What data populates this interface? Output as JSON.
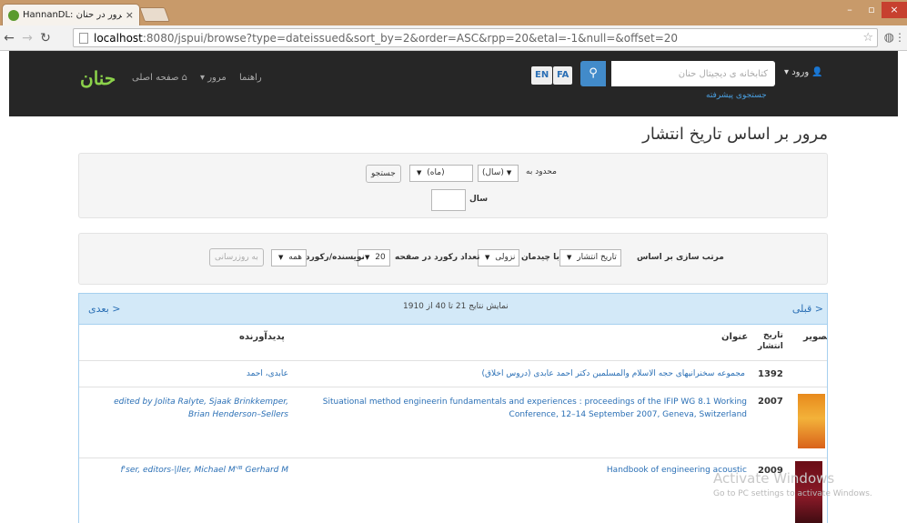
{
  "browser": {
    "tab_title": "HannanDL: مرور در حنان",
    "tab_close": "×",
    "url_host": "localhost",
    "url_path": ":8080/jspui/browse?type=dateissued&sort_by=2&order=ASC&rpp=20&etal=-1&null=&offset=20",
    "window_min": "–",
    "window_max": "▫",
    "window_close": "×"
  },
  "navbar": {
    "logo": "حنان",
    "home": "صفحه اصلی",
    "browse": "مرور",
    "help": "راهنما",
    "lang_en": "EN",
    "lang_fa": "FA",
    "search_placeholder": "کتابخانه ی دیجیتال حنان",
    "login": "ورود",
    "advanced_search": "جستجوی پیشرفته"
  },
  "page": {
    "title": "مرور بر اساس تاریخ انتشار"
  },
  "date_filter": {
    "limit_label": "محدود به",
    "year_select": "(سال)",
    "month_select": "(ماه)",
    "search_button": "جستجو",
    "year_label": "سال"
  },
  "sort_controls": {
    "sort_by_label": "مرتب سازی بر اساس",
    "sort_by_value": "تاریخ انتشار",
    "order_label": "با چیدمان",
    "order_value": "نزولی",
    "rpp_label": "تعداد رکورد در صفحه",
    "rpp_value": "20",
    "authors_label": "نویسنده/رکورد",
    "authors_value": "همه",
    "update_button": "به روزرسانی"
  },
  "results": {
    "prev": "< قبلی",
    "next": "بعدی >",
    "summary": "نمایش نتایج 21 تا 40 از 1910",
    "col_thumbnail": "تصویر",
    "col_date_line1": "تاریخ",
    "col_date_line2": "انتشار",
    "col_title": "عنوان",
    "col_author": "پدیدآورنده",
    "rows": [
      {
        "year": "1392",
        "title": "مجموعه سخنرانیهای حجه الاسلام والمسلمین دکتر احمد عابدی (دروس اخلاق)",
        "author": "عابدی، احمد"
      },
      {
        "year": "2007",
        "title_line1": "Situational method engineerin fundamentals and experiences : proceedings of the IFIP WG 8.1 Working",
        "title_line2": "Conference, 12–14 September 2007, Geneva, Switzerland",
        "author_line1": "edited by Jolita Ralyte, Sjaak Brinkkemper,",
        "author_line2": "Brian Henderson–Sellers"
      },
      {
        "year": "2009",
        "title": "Handbook of engineering acoustic",
        "author": "f'ser, editors-|ller, Michael M'ᴵᴮ Gerhard M"
      }
    ]
  },
  "watermark": {
    "title": "Activate Windows",
    "subtitle": "Go to PC settings to activate Windows."
  }
}
